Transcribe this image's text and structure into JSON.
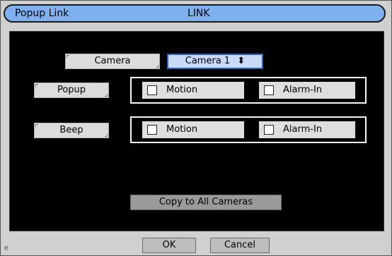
{
  "title": {
    "left": "Popup Link",
    "center": "LINK"
  },
  "camera": {
    "label": "Camera",
    "value": "Camera 1"
  },
  "rows": [
    {
      "label": "Popup",
      "options": [
        {
          "label": "Motion",
          "checked": false
        },
        {
          "label": "Alarm-In",
          "checked": false
        }
      ]
    },
    {
      "label": "Beep",
      "options": [
        {
          "label": "Motion",
          "checked": false
        },
        {
          "label": "Alarm-In",
          "checked": false
        }
      ]
    }
  ],
  "copy_button": "Copy to All Cameras",
  "ok_button": "OK",
  "cancel_button": "Cancel",
  "footer_mark": "e"
}
